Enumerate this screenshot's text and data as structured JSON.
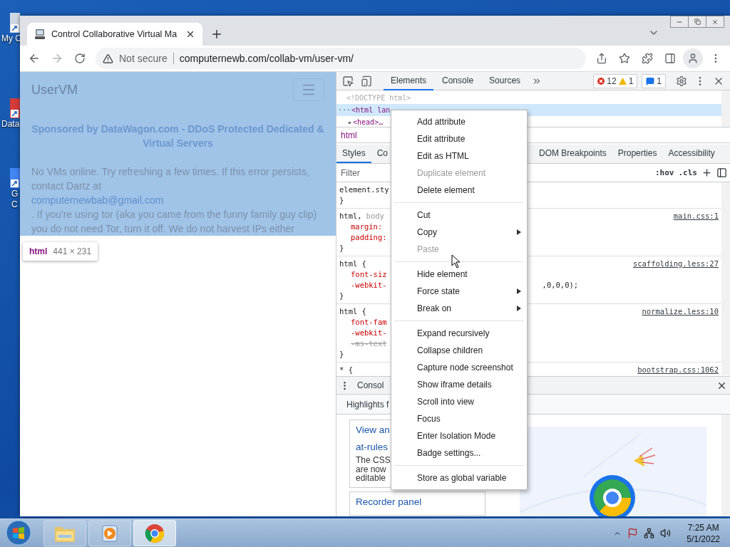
{
  "desktop": {
    "icons": [
      {
        "lines": [
          "My C"
        ]
      },
      {
        "lines": [
          "Data"
        ]
      },
      {
        "lines": [
          "G",
          "C"
        ]
      }
    ]
  },
  "browser": {
    "tab": {
      "title": "Control Collaborative Virtual Ma"
    },
    "address": {
      "security": "Not secure",
      "url": "computernewb.com/collab-vm/user-vm/"
    }
  },
  "page": {
    "brand": "UserVM",
    "sponsor": "Sponsored by DataWagon.com - DDoS Protected Dedicated & Virtual Servers",
    "notice": "No VMs online. Try refreshing a few times. If this error persists, contact Dartz at",
    "email": "computernewbab@gmail.com",
    "notice_2": ". If you're using tor (aka you came from the funny family guy clip) you do not need Tor, turn it off. We do not harvest IPs either"
  },
  "inspect_tooltip": {
    "tag": "html",
    "size": "441 × 231"
  },
  "devtools": {
    "tabs": [
      {
        "label": "Elements",
        "selected": true
      },
      {
        "label": "Console",
        "selected": false
      },
      {
        "label": "Sources",
        "selected": false
      }
    ],
    "errors": "12",
    "warnings": "1",
    "messages": "1",
    "dom": [
      {
        "text": "<!DOCTYPE html>",
        "selected": false,
        "kind": "doctype"
      },
      {
        "prefix": "···",
        "text": "<html lan",
        "selected": true,
        "kind": "element"
      },
      {
        "prefix": "▸",
        "text": "<head>…",
        "selected": false,
        "kind": "collapsed"
      }
    ],
    "breadcrumb": "html",
    "style_tabs": [
      {
        "label": "Styles",
        "selected": true
      },
      {
        "label": "Co",
        "selected": false
      },
      {
        "label": "DOM Breakpoints",
        "selected": false
      },
      {
        "label": "Properties",
        "selected": false
      },
      {
        "label": "Accessibility",
        "selected": false
      }
    ],
    "filter": {
      "placeholder": "Filter"
    },
    "hov": ":hov",
    "cls": ".cls",
    "rules": [
      {
        "selector": "element.sty",
        "closing": "}"
      },
      {
        "selector": "html,",
        "selector_dim": "body",
        "source": "main.css:1",
        "props": [
          {
            "name": "margin:",
            "struck": false
          },
          {
            "name": "padding:",
            "struck": false
          }
        ],
        "closing": "}"
      },
      {
        "selector": "html {",
        "source": "scaffolding.less:27",
        "props": [
          {
            "name": "font-siz",
            "struck": false
          },
          {
            "name": "-webkit-",
            "struck": false,
            "tail": ",0,0,0);"
          }
        ],
        "closing": "}"
      },
      {
        "selector": "html {",
        "source": "normalize.less:10",
        "props": [
          {
            "name": "font-fam",
            "struck": false
          },
          {
            "name": "-webkit-",
            "struck": false
          },
          {
            "name": "-ms-text",
            "struck": true
          }
        ],
        "closing": "}"
      },
      {
        "selector": "* {",
        "source": "bootstrap.css:1062"
      }
    ],
    "drawer": {
      "tab": "Consol",
      "panel_tab": "Highlights f",
      "cards": [
        {
          "lines": [
            "View an",
            "at-rules"
          ],
          "body": [
            "The CSS",
            "are now",
            "editable"
          ]
        },
        {
          "lines": [
            "Recorder panel"
          ]
        }
      ]
    }
  },
  "context_menu": {
    "items": [
      {
        "kind": "item",
        "label": "Add attribute",
        "disabled": false,
        "submenu": false
      },
      {
        "kind": "item",
        "label": "Edit attribute",
        "disabled": false,
        "submenu": false
      },
      {
        "kind": "item",
        "label": "Edit as HTML",
        "disabled": false,
        "submenu": false
      },
      {
        "kind": "item",
        "label": "Duplicate element",
        "disabled": true,
        "submenu": false
      },
      {
        "kind": "item",
        "label": "Delete element",
        "disabled": false,
        "submenu": false
      },
      {
        "kind": "separator"
      },
      {
        "kind": "item",
        "label": "Cut",
        "disabled": false,
        "submenu": false
      },
      {
        "kind": "item",
        "label": "Copy",
        "disabled": false,
        "submenu": true
      },
      {
        "kind": "item",
        "label": "Paste",
        "disabled": true,
        "submenu": false
      },
      {
        "kind": "separator"
      },
      {
        "kind": "item",
        "label": "Hide element",
        "disabled": false,
        "submenu": false
      },
      {
        "kind": "item",
        "label": "Force state",
        "disabled": false,
        "submenu": true
      },
      {
        "kind": "item",
        "label": "Break on",
        "disabled": false,
        "submenu": true
      },
      {
        "kind": "separator"
      },
      {
        "kind": "item",
        "label": "Expand recursively",
        "disabled": false,
        "submenu": false
      },
      {
        "kind": "item",
        "label": "Collapse children",
        "disabled": false,
        "submenu": false
      },
      {
        "kind": "item",
        "label": "Capture node screenshot",
        "disabled": false,
        "submenu": false
      },
      {
        "kind": "item",
        "label": "Show iframe details",
        "disabled": false,
        "submenu": false
      },
      {
        "kind": "item",
        "label": "Scroll into view",
        "disabled": false,
        "submenu": false
      },
      {
        "kind": "item",
        "label": "Focus",
        "disabled": false,
        "submenu": false
      },
      {
        "kind": "item",
        "label": "Enter Isolation Mode",
        "disabled": false,
        "submenu": false
      },
      {
        "kind": "item",
        "label": "Badge settings...",
        "disabled": false,
        "submenu": false
      },
      {
        "kind": "separator"
      },
      {
        "kind": "item",
        "label": "Store as global variable",
        "disabled": false,
        "submenu": false
      }
    ]
  },
  "taskbar": {
    "apps": [
      {
        "kind": "folder",
        "selected": false
      },
      {
        "kind": "media",
        "selected": false
      },
      {
        "kind": "browser",
        "selected": true
      }
    ],
    "time": "7:25 AM",
    "date": "5/1/2022"
  }
}
